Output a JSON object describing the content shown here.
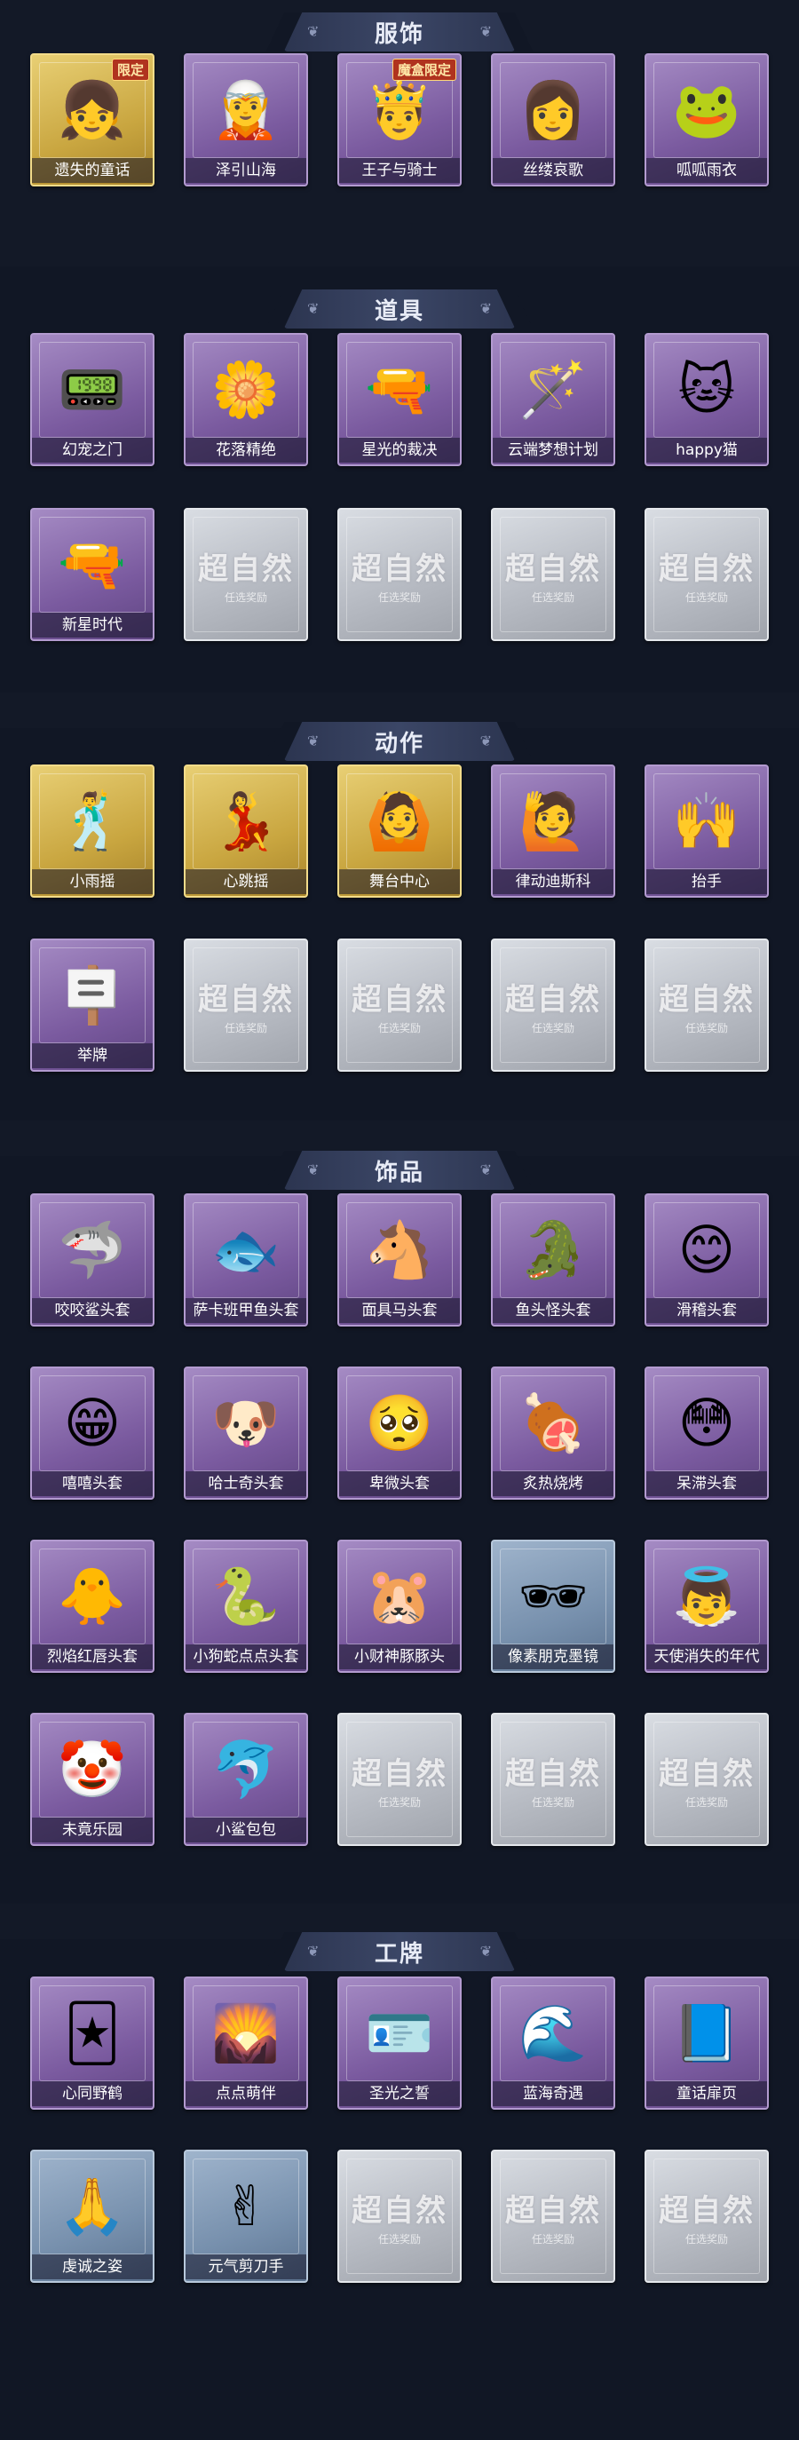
{
  "sections": {
    "costume": {
      "title": "服饰",
      "items": [
        {
          "name": "遗失的童话",
          "badge": "限定",
          "tier": "gold",
          "icon": "girl-portrait-icon",
          "glyph": "👧"
        },
        {
          "name": "泽引山海",
          "badge": "",
          "tier": "purple",
          "icon": "elf-portrait-icon",
          "glyph": "🧝"
        },
        {
          "name": "王子与骑士",
          "badge": "魔盒限定",
          "tier": "purple",
          "icon": "prince-portrait-icon",
          "glyph": "🤴"
        },
        {
          "name": "丝缕哀歌",
          "badge": "",
          "tier": "purple",
          "icon": "doll-portrait-icon",
          "glyph": "👩"
        },
        {
          "name": "呱呱雨衣",
          "badge": "",
          "tier": "purple",
          "icon": "frog-raincoat-portrait-icon",
          "glyph": "🐸"
        }
      ]
    },
    "props": {
      "title": "道具",
      "items": [
        {
          "name": "幻宠之门",
          "tier": "purple",
          "icon": "pet-device-icon",
          "glyph": "📟"
        },
        {
          "name": "花落精绝",
          "tier": "purple",
          "icon": "flower-pendant-icon",
          "glyph": "🌼"
        },
        {
          "name": "星光的裁决",
          "tier": "purple",
          "icon": "rifle-icon",
          "glyph": "🔫"
        },
        {
          "name": "云端梦想计划",
          "tier": "purple",
          "icon": "scepter-icon",
          "glyph": "🪄"
        },
        {
          "name": "happy猫",
          "tier": "purple",
          "icon": "cat-figure-icon",
          "glyph": "🐱"
        },
        {
          "name": "新星时代",
          "tier": "purple",
          "icon": "revolver-icon",
          "glyph": "🔫"
        }
      ],
      "empty_slots": 4
    },
    "actions": {
      "title": "动作",
      "items": [
        {
          "name": "小雨摇",
          "tier": "gold",
          "icon": "rain-dance-pose-icon",
          "glyph": "🕺"
        },
        {
          "name": "心跳摇",
          "tier": "gold",
          "icon": "heartbeat-pose-icon",
          "glyph": "💃"
        },
        {
          "name": "舞台中心",
          "tier": "gold",
          "icon": "stage-pose-icon",
          "glyph": "🙆"
        },
        {
          "name": "律动迪斯科",
          "tier": "purple",
          "icon": "disco-pose-icon",
          "glyph": "🙋"
        },
        {
          "name": "抬手",
          "tier": "purple",
          "icon": "raise-hand-pose-icon",
          "glyph": "🙌"
        },
        {
          "name": "举牌",
          "tier": "purple",
          "icon": "hold-sign-pose-icon",
          "glyph": "🪧"
        }
      ],
      "empty_slots": 4
    },
    "accessories": {
      "title": "饰品",
      "items": [
        {
          "name": "咬咬鲨头套",
          "tier": "purple",
          "icon": "shark-head-icon",
          "glyph": "🦈"
        },
        {
          "name": "萨卡班甲鱼头套",
          "tier": "purple",
          "icon": "fish-head-icon",
          "glyph": "🐟"
        },
        {
          "name": "面具马头套",
          "tier": "purple",
          "icon": "horse-head-icon",
          "glyph": "🐴"
        },
        {
          "name": "鱼头怪头套",
          "tier": "purple",
          "icon": "fish-monster-head-icon",
          "glyph": "🐊"
        },
        {
          "name": "滑稽头套",
          "tier": "purple",
          "icon": "smirk-face-icon",
          "glyph": "😊"
        },
        {
          "name": "嘻嘻头套",
          "tier": "purple",
          "icon": "grin-face-icon",
          "glyph": "😁"
        },
        {
          "name": "哈士奇头套",
          "tier": "purple",
          "icon": "dog-head-icon",
          "glyph": "🐶"
        },
        {
          "name": "卑微头套",
          "tier": "purple",
          "icon": "humble-face-icon",
          "glyph": "🥺"
        },
        {
          "name": "炙热烧烤",
          "tier": "purple",
          "icon": "bbq-head-icon",
          "glyph": "🍖"
        },
        {
          "name": "呆滞头套",
          "tier": "purple",
          "icon": "dazed-face-icon",
          "glyph": "😳"
        },
        {
          "name": "烈焰红唇头套",
          "tier": "purple",
          "icon": "lips-head-icon",
          "glyph": "🐥"
        },
        {
          "name": "小狗蛇点点头套",
          "tier": "purple",
          "icon": "snake-head-icon",
          "glyph": "🐍"
        },
        {
          "name": "小财神豚豚头",
          "tier": "purple",
          "icon": "capybara-head-icon",
          "glyph": "🐹"
        },
        {
          "name": "像素朋克墨镜",
          "tier": "blue",
          "icon": "pixel-sunglasses-icon",
          "glyph": "🕶"
        },
        {
          "name": "天使消失的年代",
          "tier": "purple",
          "icon": "angel-doll-icon",
          "glyph": "👼"
        },
        {
          "name": "未竟乐园",
          "tier": "purple",
          "icon": "clown-doll-icon",
          "glyph": "🤡"
        },
        {
          "name": "小鲨包包",
          "tier": "purple",
          "icon": "shark-bag-icon",
          "glyph": "🐬"
        }
      ],
      "empty_slots": 3
    },
    "badges": {
      "title": "工牌",
      "items": [
        {
          "name": "心同野鹤",
          "tier": "purple",
          "icon": "crane-card-icon",
          "glyph": "🃏"
        },
        {
          "name": "点点萌伴",
          "tier": "purple",
          "icon": "field-card-icon",
          "glyph": "🌄"
        },
        {
          "name": "圣光之誓",
          "tier": "purple",
          "icon": "holy-light-card-icon",
          "glyph": "🪪"
        },
        {
          "name": "蓝海奇遇",
          "tier": "purple",
          "icon": "blue-sea-card-icon",
          "glyph": "🌊"
        },
        {
          "name": "童话扉页",
          "tier": "purple",
          "icon": "fairytale-card-icon",
          "glyph": "📘"
        },
        {
          "name": "虔诚之姿",
          "tier": "blue",
          "icon": "pious-silhouette-card-icon",
          "glyph": "🙏"
        },
        {
          "name": "元气剪刀手",
          "tier": "blue",
          "icon": "peace-sign-silhouette-card-icon",
          "glyph": "✌"
        }
      ],
      "empty_slots": 3
    }
  },
  "empty_slot": {
    "big": "超自然",
    "small": "任选奖励"
  },
  "colors": {
    "background": "#111725",
    "purple": "#7a5a9f",
    "gold": "#c9a640",
    "blue": "#7790ad",
    "empty": "#b8bcc4"
  }
}
